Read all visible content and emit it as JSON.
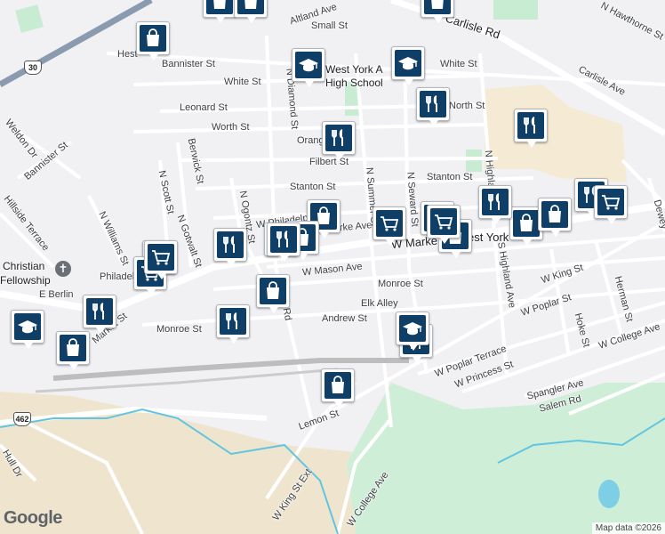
{
  "streets": [
    "Altland Ave",
    "Small St",
    "Bannister St",
    "White St",
    "White St",
    "Leonard St",
    "Worth St",
    "North St",
    "Orange",
    "Filbert St",
    "Stanton St",
    "Stanton St",
    "W Philadelphia",
    "W Clarke Ave",
    "W Market St",
    "W Mason Ave",
    "Monroe St",
    "Monroe St",
    "Elk Alley",
    "Andrew St",
    "W King St",
    "W Poplar St",
    "W Poplar Terrace",
    "W Princess St",
    "W College Ave",
    "Spangler Ave",
    "Salem Rd",
    "Lemon St",
    "W King St Ext",
    "W College Ave",
    "Carlisle Rd",
    "Carlisle Ave",
    "N Hawthorne St",
    "Hest",
    "N Diamond St",
    "N Summer St",
    "N Seward St",
    "N Highland",
    "S Highland Ave",
    "Hoke St",
    "Herman St",
    "Dewey",
    "Berwick St",
    "N Scott St",
    "N Gotwalt St",
    "N Williams St",
    "Weldon Dr",
    "Bannister St",
    "Hillside Terrace",
    "N Ogontz St",
    "E Berlin",
    "Hull Dr",
    "Philadelph",
    "Market St",
    "Hill Rd"
  ],
  "places": {
    "school": "West York Area High School",
    "school_line1": "West York A",
    "school_line2": "High School",
    "church_line1": "Christian",
    "church_line2": "Fellowship",
    "town": "West York"
  },
  "route_shields": [
    "30",
    "462"
  ],
  "pins": [
    {
      "icon": "shopping-bag-icon",
      "count": 12
    },
    {
      "icon": "restaurant-icon",
      "count": 12
    },
    {
      "icon": "shopping-cart-icon",
      "count": 6
    },
    {
      "icon": "school-icon",
      "count": 4
    }
  ],
  "attribution": {
    "logo": "Google",
    "text": "Map data ©2026"
  },
  "colors": {
    "pin_fill": "#0f3f66",
    "road": "#ffffff",
    "highway": "#8a9bb0",
    "park": "#c8ecd2",
    "beige": "#f5ead3",
    "railway": "#bdbdbd",
    "water": "#62c5e0",
    "background": "#f1f1f4"
  }
}
